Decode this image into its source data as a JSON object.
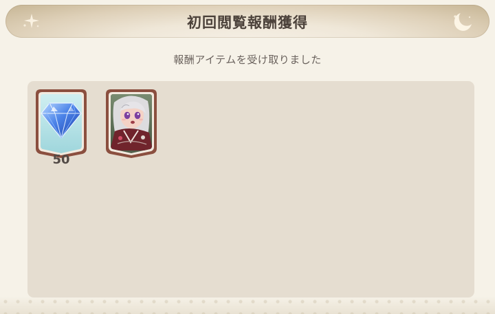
{
  "title": "初回閲覧報酬獲得",
  "subtitle": "報酬アイテムを受け取りました",
  "rewards": [
    {
      "type": "gem",
      "icon": "blue-gem-icon",
      "quantity": "50"
    },
    {
      "type": "character",
      "icon": "character-portrait"
    }
  ],
  "colors": {
    "background": "#f6f2e8",
    "title_bar": "#ded0b8",
    "panel": "#e5ddd0",
    "frame": "#8b4f3f",
    "gem": "#4b83e8"
  }
}
